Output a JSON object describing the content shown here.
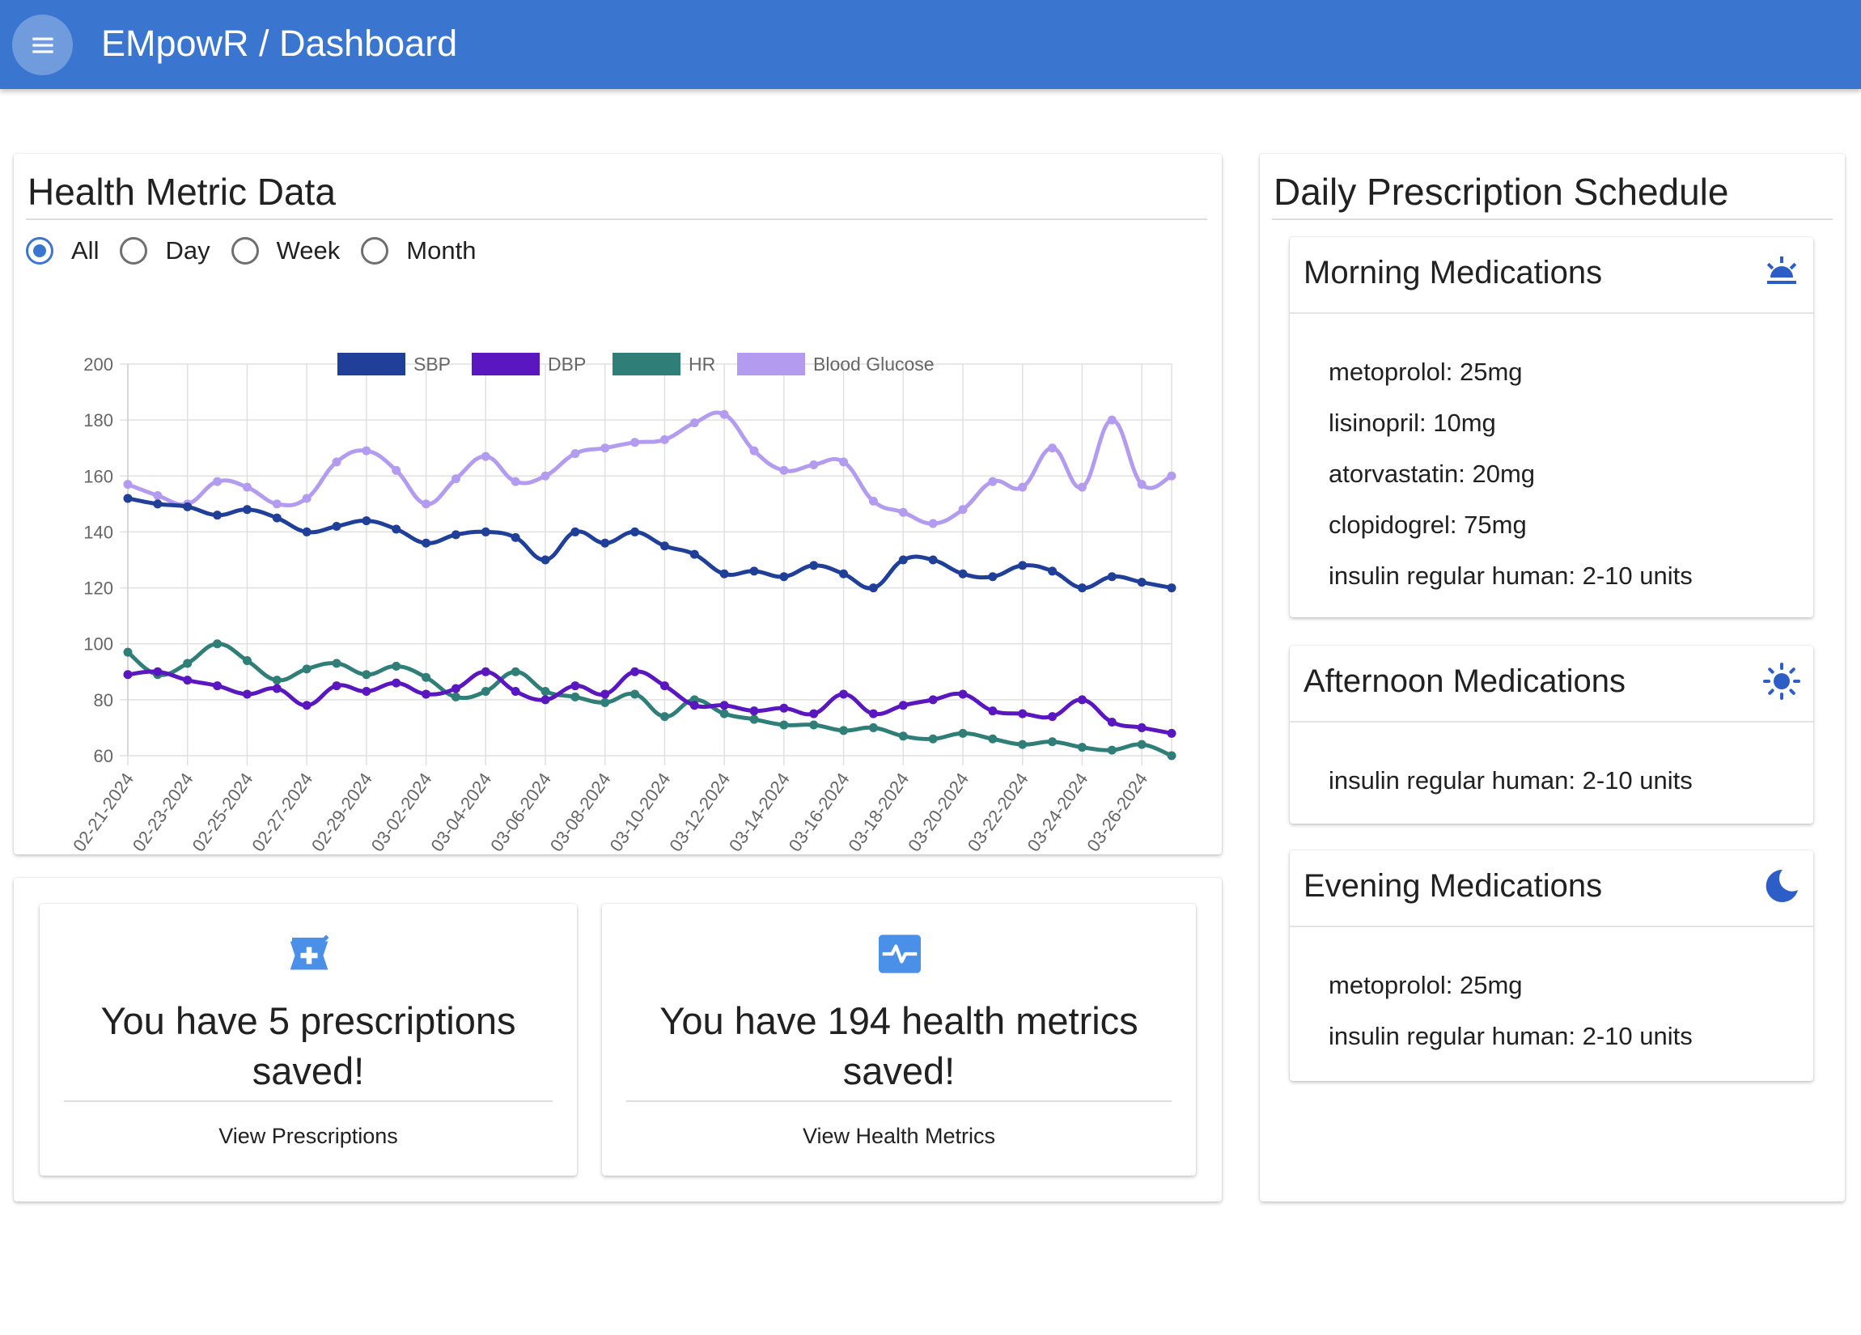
{
  "app": {
    "title": "EMpowR / Dashboard"
  },
  "colors": {
    "primary": "#3a76d0",
    "icon": "#4a8fe8",
    "sbp": "#1f3f99",
    "dbp": "#5a17c0",
    "hr": "#2f7f78",
    "glucose": "#b39cf0"
  },
  "metrics": {
    "title": "Health Metric Data",
    "filters": [
      {
        "label": "All",
        "selected": true
      },
      {
        "label": "Day",
        "selected": false
      },
      {
        "label": "Week",
        "selected": false
      },
      {
        "label": "Month",
        "selected": false
      }
    ]
  },
  "chart_data": {
    "type": "line",
    "x": [
      "02-21-2024",
      "02-22-2024",
      "02-23-2024",
      "02-24-2024",
      "02-25-2024",
      "02-26-2024",
      "02-27-2024",
      "02-28-2024",
      "02-29-2024",
      "03-01-2024",
      "03-02-2024",
      "03-03-2024",
      "03-04-2024",
      "03-05-2024",
      "03-06-2024",
      "03-07-2024",
      "03-08-2024",
      "03-09-2024",
      "03-10-2024",
      "03-11-2024",
      "03-12-2024",
      "03-13-2024",
      "03-14-2024",
      "03-15-2024",
      "03-16-2024",
      "03-17-2024",
      "03-18-2024",
      "03-19-2024",
      "03-20-2024",
      "03-21-2024",
      "03-22-2024",
      "03-23-2024",
      "03-24-2024",
      "03-25-2024",
      "03-26-2024",
      "03-27-2024"
    ],
    "x_tick_labels": [
      "02-21-2024",
      "02-23-2024",
      "02-25-2024",
      "02-27-2024",
      "02-29-2024",
      "03-02-2024",
      "03-04-2024",
      "03-06-2024",
      "03-08-2024",
      "03-10-2024",
      "03-12-2024",
      "03-14-2024",
      "03-16-2024",
      "03-18-2024",
      "03-20-2024",
      "03-22-2024",
      "03-24-2024",
      "03-26-2024"
    ],
    "ylim": [
      60,
      200
    ],
    "yticks": [
      60,
      80,
      100,
      120,
      140,
      160,
      180,
      200
    ],
    "grid": true,
    "legend_position": "top",
    "series": [
      {
        "name": "SBP",
        "color": "#1f3f99",
        "values": [
          152,
          150,
          149,
          146,
          148,
          145,
          140,
          142,
          144,
          141,
          136,
          139,
          140,
          138,
          130,
          140,
          136,
          140,
          135,
          132,
          125,
          126,
          124,
          128,
          125,
          120,
          130,
          130,
          125,
          124,
          128,
          126,
          120,
          124,
          122,
          120
        ]
      },
      {
        "name": "DBP",
        "color": "#5a17c0",
        "values": [
          89,
          90,
          87,
          85,
          82,
          84,
          78,
          85,
          83,
          86,
          82,
          84,
          90,
          83,
          80,
          85,
          82,
          90,
          85,
          78,
          78,
          76,
          77,
          75,
          82,
          75,
          78,
          80,
          82,
          76,
          75,
          74,
          80,
          72,
          70,
          68
        ]
      },
      {
        "name": "HR",
        "color": "#2f7f78",
        "values": [
          97,
          89,
          93,
          100,
          94,
          87,
          91,
          93,
          89,
          92,
          88,
          81,
          83,
          90,
          83,
          81,
          79,
          82,
          74,
          80,
          75,
          73,
          71,
          71,
          69,
          70,
          67,
          66,
          68,
          66,
          64,
          65,
          63,
          62,
          64,
          60
        ]
      },
      {
        "name": "Blood Glucose",
        "color": "#b39cf0",
        "values": [
          157,
          153,
          150,
          158,
          156,
          150,
          152,
          165,
          169,
          162,
          150,
          159,
          167,
          158,
          160,
          168,
          170,
          172,
          173,
          179,
          182,
          169,
          162,
          164,
          165,
          151,
          147,
          143,
          148,
          158,
          156,
          170,
          156,
          180,
          157,
          160
        ]
      }
    ]
  },
  "summary": {
    "prescriptions": {
      "text": "You have 5 prescriptions saved!",
      "link": "View Prescriptions",
      "icon": "prescription-icon"
    },
    "health_metrics": {
      "text": "You have 194 health metrics saved!",
      "link": "View Health Metrics",
      "icon": "monitor-heart-icon"
    }
  },
  "schedule": {
    "title": "Daily Prescription Schedule",
    "morning": {
      "title": "Morning Medications",
      "icon": "sunrise-icon",
      "items": [
        "metoprolol: 25mg",
        "lisinopril: 10mg",
        "atorvastatin: 20mg",
        "clopidogrel: 75mg",
        "insulin regular human: 2-10 units"
      ]
    },
    "afternoon": {
      "title": "Afternoon Medications",
      "icon": "sun-icon",
      "items": [
        "insulin regular human: 2-10 units"
      ]
    },
    "evening": {
      "title": "Evening Medications",
      "icon": "moon-icon",
      "items": [
        "metoprolol: 25mg",
        "insulin regular human: 2-10 units"
      ]
    }
  }
}
